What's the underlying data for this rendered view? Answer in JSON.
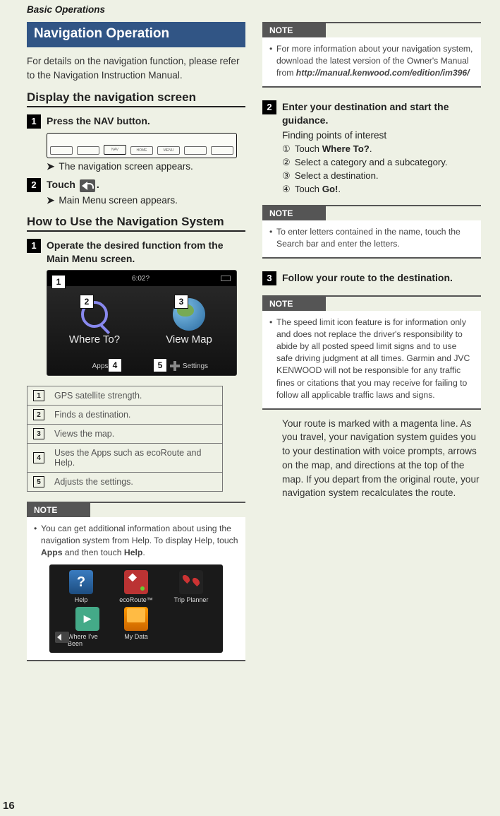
{
  "breadcrumb": "Basic Operations",
  "page_number": "16",
  "left": {
    "section_bar": "Navigation Operation",
    "intro": "For details on the navigation function, please refer to the Navigation Instruction Manual.",
    "h2_display": "Display the navigation screen",
    "step1": {
      "text_pre": "Press the ",
      "button": "NAV",
      "text_post": " button.",
      "result": "The navigation screen appears."
    },
    "step2": {
      "text_pre": "Touch ",
      "text_post": ".",
      "result": "Main Menu screen appears."
    },
    "h2_how": "How to Use the Navigation System",
    "step_how1": "Operate the desired function from the Main Menu screen.",
    "nav_shot": {
      "time": "6:02?",
      "where_to": "Where To?",
      "view_map": "View Map",
      "apps": "Apps",
      "settings": "Settings"
    },
    "legend": [
      {
        "n": "1",
        "d": "GPS satellite strength."
      },
      {
        "n": "2",
        "d": "Finds a destination."
      },
      {
        "n": "3",
        "d": "Views the map."
      },
      {
        "n": "4",
        "d": "Uses the Apps such as ecoRoute and Help."
      },
      {
        "n": "5",
        "d": "Adjusts the settings."
      }
    ],
    "note1_head": "NOTE",
    "note1_text_pre": "You can get additional information about using the navigation system from Help. To display Help, touch ",
    "note1_apps": "Apps",
    "note1_mid": " and then touch ",
    "note1_help": "Help",
    "note1_post": ".",
    "apps_shot": {
      "help": "Help",
      "eco": "ecoRoute™",
      "trip": "Trip Planner",
      "where": "Where I've Been",
      "data": "My Data"
    }
  },
  "right": {
    "note2_head": "NOTE",
    "note2_text_pre": "For more information about your navigation system, download the latest version of the Owner's Manual from ",
    "note2_url": "http://manual.kenwood.com/edition/im396/",
    "step2_head": "Enter your destination and start the guidance.",
    "step2_sub": "Finding points of interest",
    "circ": [
      {
        "pre": "Touch ",
        "label": "Where To?",
        "post": "."
      },
      {
        "text": "Select a category and a subcategory."
      },
      {
        "text": "Select a destination."
      },
      {
        "pre": "Touch ",
        "label": "Go!",
        "post": "."
      }
    ],
    "note3_head": "NOTE",
    "note3_text": "To enter letters contained in the name, touch the Search bar and enter the letters.",
    "step3_head": "Follow your route to the destination.",
    "note4_head": "NOTE",
    "note4_text": "The speed limit icon feature is for information only and does not replace the driver's responsibility to abide by all posted speed limit signs and to use safe driving judgment at all times. Garmin and JVC KENWOOD will not be responsible for any traffic fines or citations that you may receive for failing to follow all applicable traffic laws and signs.",
    "closing": "Your route is marked with a magenta line. As you travel, your navigation system guides you to your destination with voice prompts, arrows on the map, and directions at the top of the map. If you depart from the original route, your navigation system recalculates the route."
  }
}
